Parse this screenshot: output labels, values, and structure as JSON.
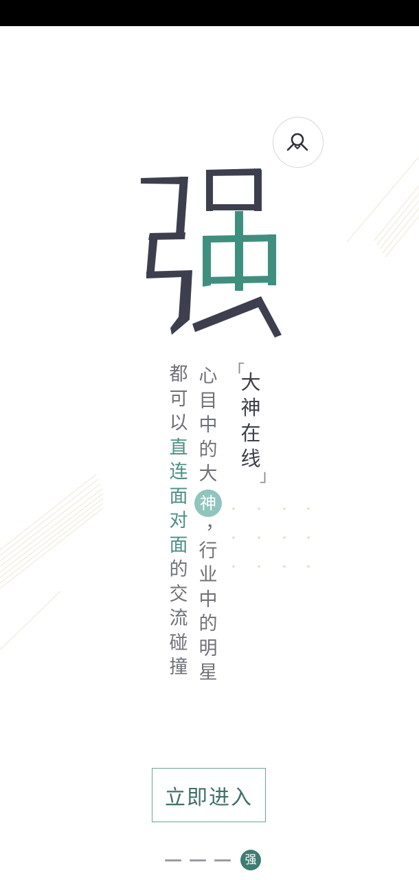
{
  "status_bar": {},
  "hero": {
    "char": "强",
    "avatar_icon": "person-icon",
    "colors": {
      "dark": "#3d3f4e",
      "accent": "#3f8f7e"
    }
  },
  "slogan": {
    "bracket_open": "「",
    "title": [
      "大",
      "神",
      "在",
      "线"
    ],
    "bracket_close": "」",
    "middle_column": {
      "before": [
        "心",
        "目",
        "中",
        "的",
        "大"
      ],
      "highlight": "神",
      "comma": "，",
      "after": [
        "行",
        "业",
        "中",
        "的",
        "明",
        "星"
      ]
    },
    "left_column": {
      "before": [
        "都",
        "可",
        "以"
      ],
      "accent_a": [
        "直",
        "连",
        "面"
      ],
      "accent_b": [
        "对",
        "面"
      ],
      "after": [
        "的",
        "交",
        "流",
        "碰",
        "撞"
      ]
    }
  },
  "enter_button": {
    "label": "立即进入"
  },
  "pager": {
    "active_label": "强",
    "inactive_count": 3
  },
  "theme": {
    "accent": "#4e8f86",
    "text": "#6f7178",
    "deco_line": "#eadfc8"
  }
}
